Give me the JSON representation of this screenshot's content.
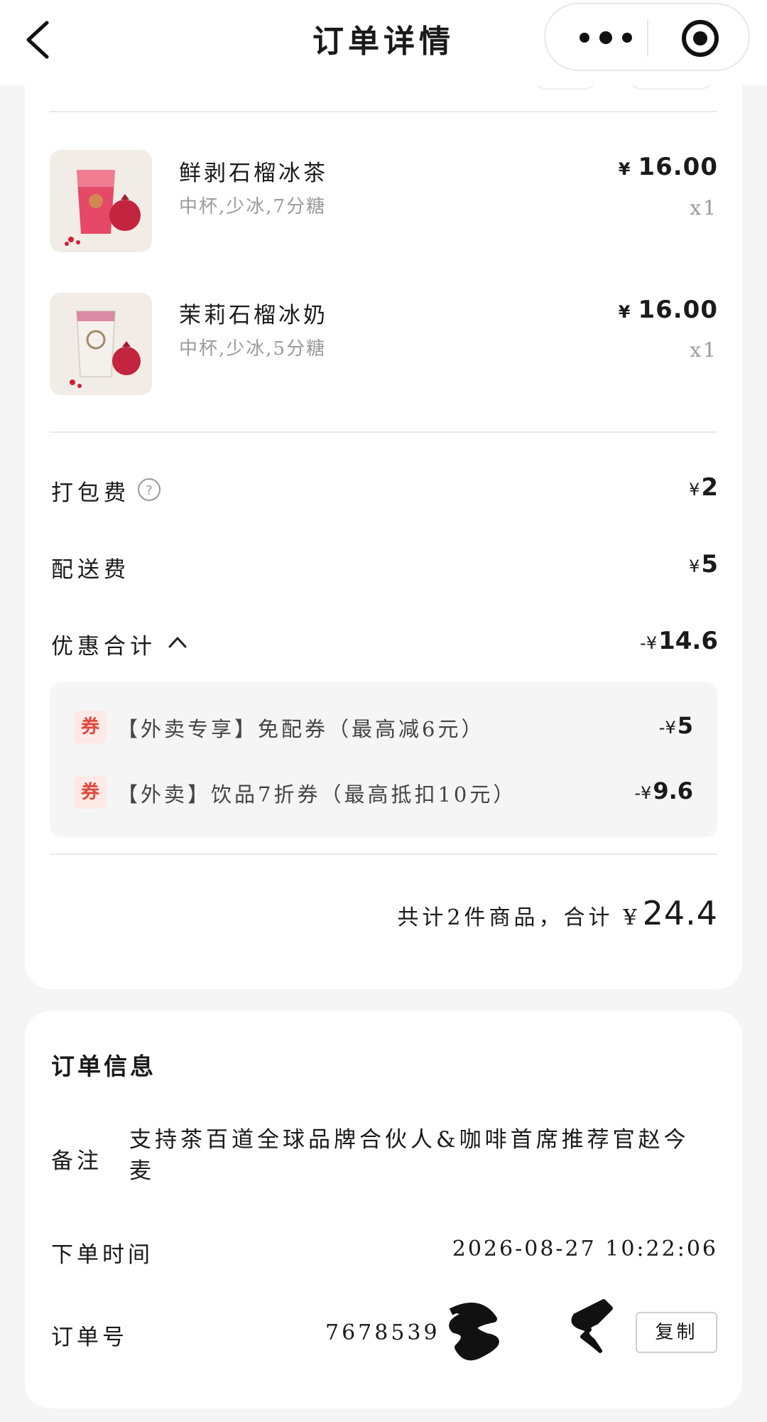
{
  "nav": {
    "title": "订单详情",
    "back_icon": "chevron-left-icon",
    "more_icon": "more-dots-icon",
    "target_icon": "target-icon"
  },
  "products": [
    {
      "name": "鲜剥石榴冰茶",
      "spec": "中杯,少冰,7分糖",
      "currency": "¥",
      "price": "16.00",
      "qty": "x1"
    },
    {
      "name": "茉莉石榴冰奶",
      "spec": "中杯,少冰,5分糖",
      "currency": "¥",
      "price": "16.00",
      "qty": "x1"
    }
  ],
  "fees": {
    "packing": {
      "label": "打包费",
      "currency": "¥",
      "value": "2"
    },
    "delivery": {
      "label": "配送费",
      "currency": "¥",
      "value": "5"
    },
    "discount": {
      "label": "优惠合计",
      "currency": "-¥",
      "value": "14.6"
    }
  },
  "coupons": [
    {
      "badge": "券",
      "text": "【外卖专享】免配券（最高减6元）",
      "currency": "-¥",
      "value": "5"
    },
    {
      "badge": "券",
      "text": "【外卖】饮品7折券（最高抵扣10元）",
      "currency": "-¥",
      "value": "9.6"
    }
  ],
  "total": {
    "text": "共计2件商品，合计",
    "currency": "¥",
    "amount": "24.4"
  },
  "order_info": {
    "title": "订单信息",
    "remark_label": "备注",
    "remark": "支持茶百道全球品牌合伙人&咖啡首席推荐官赵今麦",
    "time_label": "下单时间",
    "time": "2026-08-27 10:22:06",
    "number_label": "订单号",
    "number_visible": "7678539",
    "copy_label": "复制"
  },
  "colors": {
    "coupon_badge_bg": "#fde9e6",
    "coupon_badge_text": "#e1473a",
    "page_bg": "#f5f5f5"
  }
}
